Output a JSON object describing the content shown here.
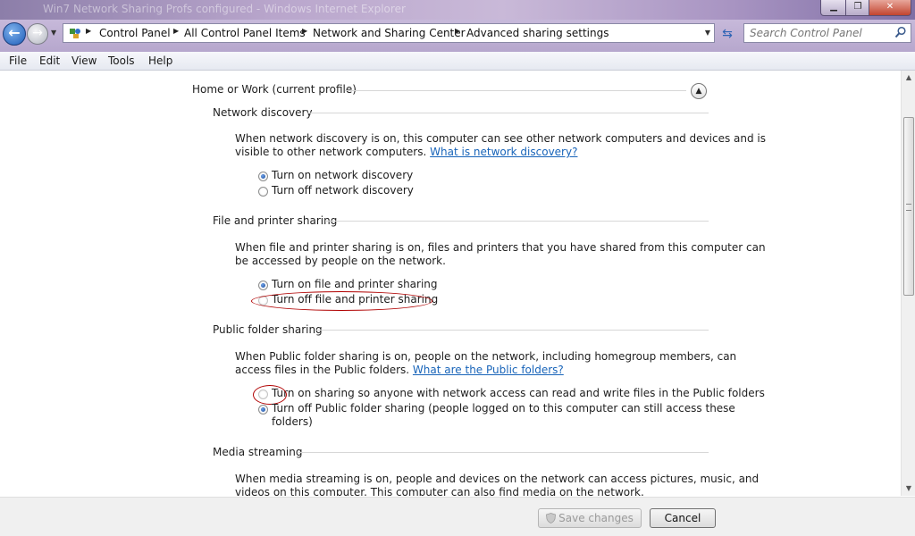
{
  "window": {
    "ghost_title": "Win7 Network Sharing Profs configured - Windows Internet Explorer",
    "minimize_label": "▁",
    "maximize_label": "❐",
    "close_label": "✕"
  },
  "address": {
    "breadcrumb": [
      "Control Panel",
      "All Control Panel Items",
      "Network and Sharing Center",
      "Advanced sharing settings"
    ],
    "icon": "control-panel-icon"
  },
  "search": {
    "placeholder": "Search Control Panel"
  },
  "menubar": {
    "items": [
      "File",
      "Edit",
      "View",
      "Tools",
      "Help"
    ]
  },
  "profile": {
    "title": "Home or Work (current profile)"
  },
  "sections": {
    "network_discovery": {
      "title": "Network discovery",
      "desc_line1": "When network discovery is on, this computer can see other network computers and devices and is",
      "desc_line2": "visible to other network computers.",
      "link": "What is network discovery?",
      "options": [
        "Turn on network discovery",
        "Turn off network discovery"
      ],
      "selected": 0
    },
    "file_printer": {
      "title": "File and printer sharing",
      "desc_line1": "When file and printer sharing is on, files and printers that you have shared from this computer can",
      "desc_line2": "be accessed by people on the network.",
      "options": [
        "Turn on file and printer sharing",
        "Turn off file and printer sharing"
      ],
      "selected": 0
    },
    "public_folder": {
      "title": "Public folder sharing",
      "desc_line1": "When Public folder sharing is on, people on the network, including homegroup members, can",
      "desc_line2": "access files in the Public folders.",
      "link": "What are the Public folders?",
      "option1": "Turn on sharing so anyone with network access can read and write files in the Public folders",
      "option2_line1": "Turn off Public folder sharing (people logged on to this computer can still access these",
      "option2_line2": "folders)",
      "selected": 1
    },
    "media_streaming": {
      "title": "Media streaming",
      "desc_line1": "When media streaming is on, people and devices on the network can access pictures, music, and",
      "desc_line2": "videos on this computer. This computer can also find media on the network."
    }
  },
  "footer": {
    "save_label": "Save changes",
    "cancel_label": "Cancel"
  },
  "colors": {
    "link": "#1864b9",
    "annotation": "#b00000",
    "titlebar": "#b9a6cc"
  }
}
